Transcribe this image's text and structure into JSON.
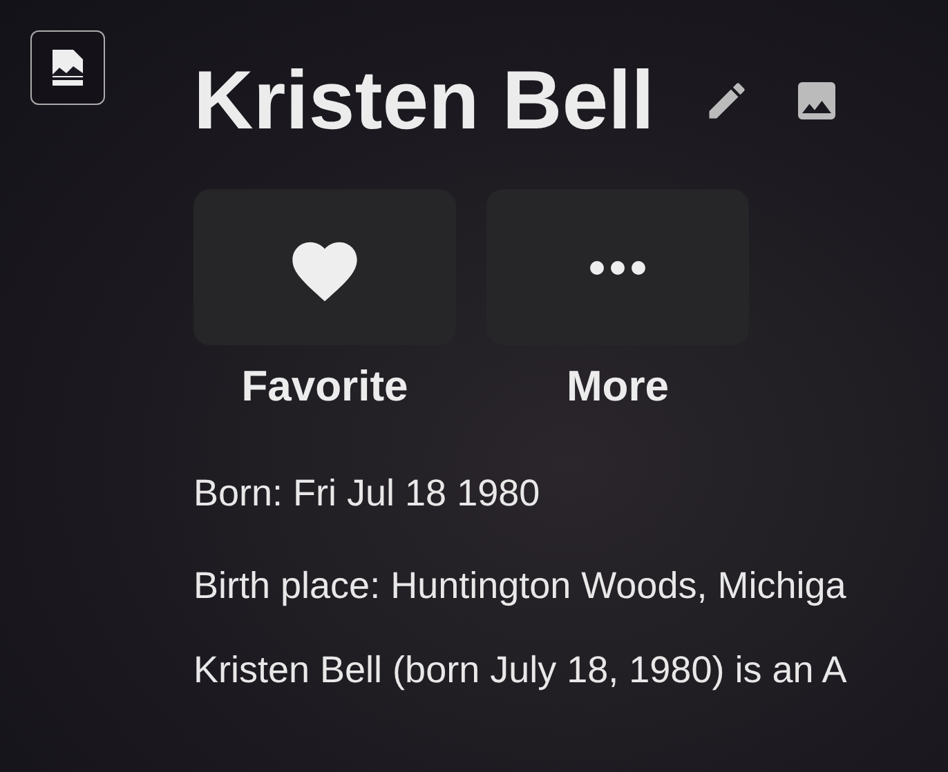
{
  "person": {
    "name": "Kristen Bell"
  },
  "actions": [
    {
      "kind": "favorite",
      "label": "Favorite"
    },
    {
      "kind": "more",
      "label": "More"
    }
  ],
  "details": [
    "Born: Fri Jul 18 1980",
    "Birth place: Huntington Woods, Michiga"
  ],
  "overview": "Kristen Bell (born July 18, 1980) is an A"
}
